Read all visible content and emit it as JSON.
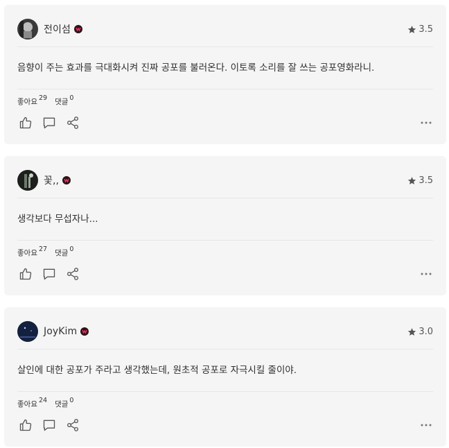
{
  "reviews": [
    {
      "username": "전이섬",
      "rating": "3.5",
      "comment": "음향이 주는 효과를 극대화시켜 진짜 공포를 불러온다. 이토록 소리를 잘 쓰는 공포영화라니.",
      "likes_label": "좋아요",
      "likes_count": "29",
      "replies_label": "댓글",
      "replies_count": "0"
    },
    {
      "username": "꽃,,",
      "rating": "3.5",
      "comment": "생각보다 무섭자나...",
      "likes_label": "좋아요",
      "likes_count": "27",
      "replies_label": "댓글",
      "replies_count": "0"
    },
    {
      "username": "JoyKim",
      "rating": "3.0",
      "comment": "살인에 대한 공포가 주라고 생각했는데, 원초적 공포로 자극시킬 줄이야.",
      "likes_label": "좋아요",
      "likes_count": "24",
      "replies_label": "댓글",
      "replies_count": "0"
    }
  ],
  "icons": {
    "star": "star-icon",
    "badge": "watcha-badge-icon",
    "like": "thumbs-up-icon",
    "comment": "speech-bubble-icon",
    "share": "share-icon",
    "more": "more-dots-icon"
  },
  "colors": {
    "card_bg": "#f5f5f5",
    "badge_bg": "#2b1416",
    "badge_accent": "#ff2f6e",
    "text": "#2f2f2f",
    "muted": "#555555"
  }
}
